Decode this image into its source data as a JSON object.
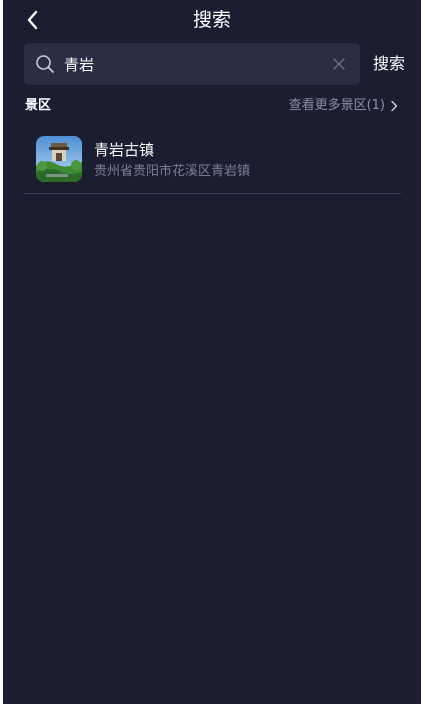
{
  "header": {
    "title": "搜索"
  },
  "search": {
    "value": "青岩",
    "submit_label": "搜索"
  },
  "section": {
    "title": "景区",
    "more_label": "查看更多景区(1)"
  },
  "results": [
    {
      "name": "青岩古镇",
      "address": "贵州省贵阳市花溪区青岩镇"
    }
  ],
  "colors": {
    "background": "#1b1d31",
    "search_box": "#2a2d44",
    "muted_text": "#7b7e96",
    "divider": "#3b3e55"
  }
}
